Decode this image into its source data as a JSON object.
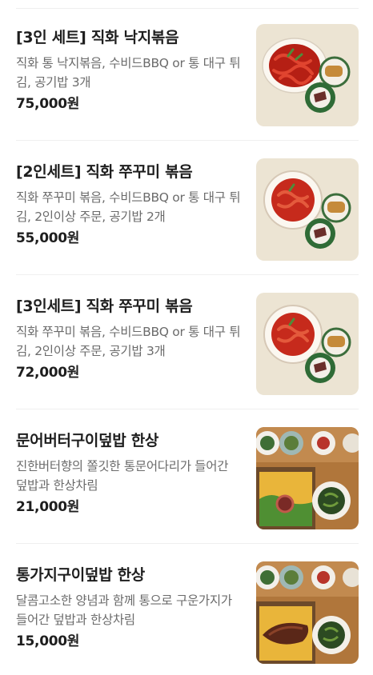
{
  "menu": {
    "items": [
      {
        "name": "[3인 세트] 직화 낙지볶음",
        "description": "직화 통 낙지볶음, 수비드BBQ or 통 대구 튀김, 공기밥 3개",
        "price": "75,000원",
        "image_icon": "octopus-stirfry-set-image"
      },
      {
        "name": "[2인세트] 직화 쭈꾸미 볶음",
        "description": "직화 쭈꾸미 볶음, 수비드BBQ or 통 대구 튀김, 2인이상 주문, 공기밥 2개",
        "price": "55,000원",
        "image_icon": "webfoot-octopus-stirfry-set-image"
      },
      {
        "name": "[3인세트] 직화 쭈꾸미 볶음",
        "description": "직화 쭈꾸미 볶음, 수비드BBQ or 통 대구 튀김, 2인이상 주문, 공기밥 3개",
        "price": "72,000원",
        "image_icon": "webfoot-octopus-stirfry-set-image"
      },
      {
        "name": "문어버터구이덮밥 한상",
        "description": "진한버터향의 쫄깃한 통문어다리가 들어간 덮밥과 한상차림",
        "price": "21,000원",
        "image_icon": "octopus-butter-rice-tray-image"
      },
      {
        "name": "통가지구이덮밥 한상",
        "description": "달콤고소한 양념과 함께 통으로 구운가지가 들어간 덮밥과 한상차림",
        "price": "15,000원",
        "image_icon": "grilled-eggplant-rice-tray-image"
      }
    ]
  },
  "colors": {
    "plate_bg": "#ece4d3",
    "sauce_red": "#c62a1c",
    "wood": "#b0763b",
    "price_text": "#1e1e1e",
    "desc_text": "#6b6b6b"
  }
}
